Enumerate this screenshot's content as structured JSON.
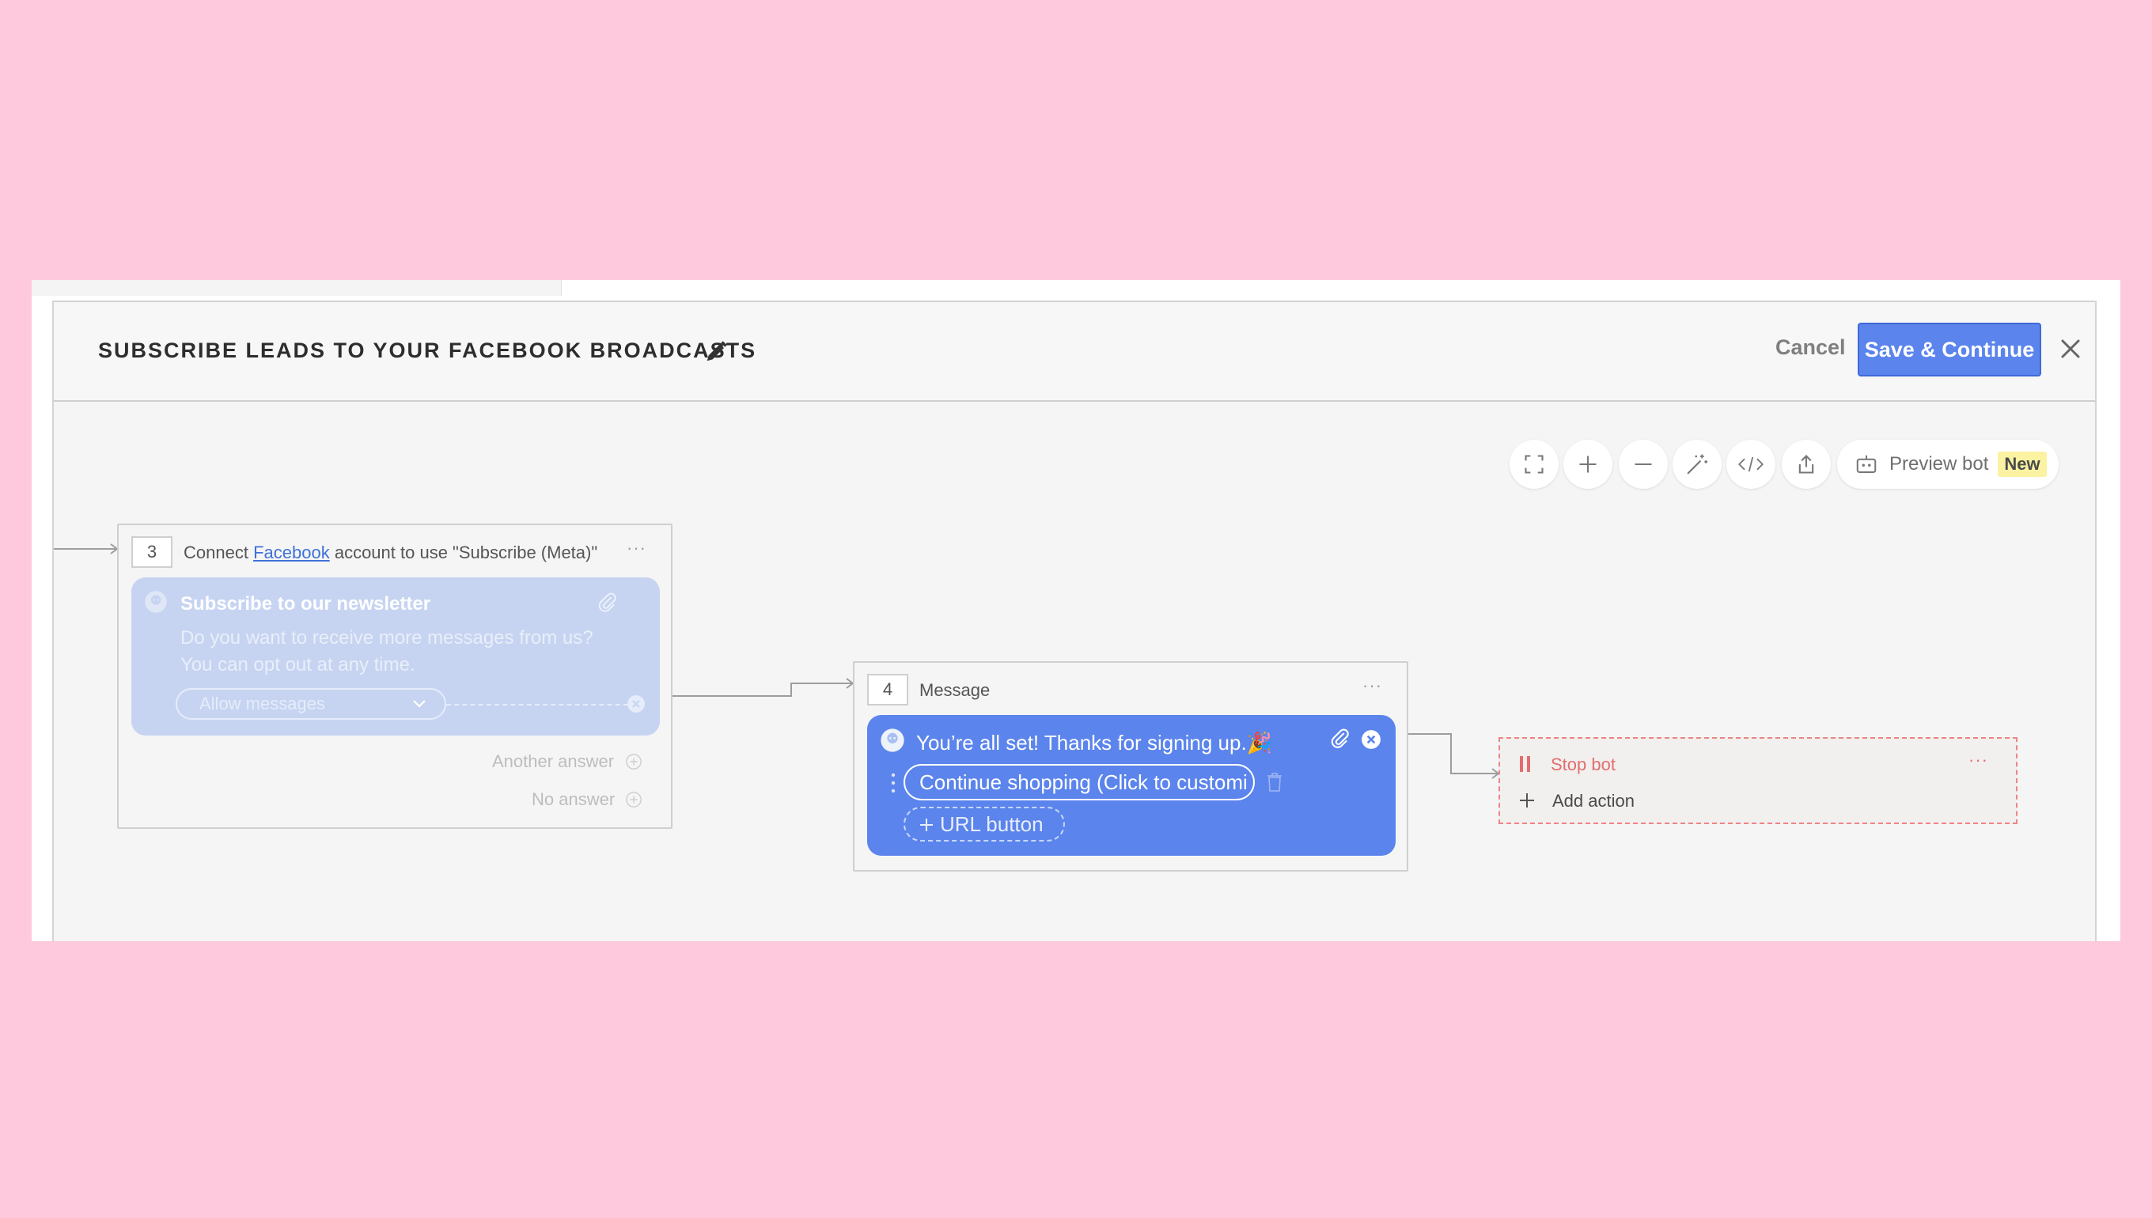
{
  "modal": {
    "title": "SUBSCRIBE LEADS TO YOUR FACEBOOK BROADCASTS",
    "cancel_label": "Cancel",
    "save_label": "Save & Continue"
  },
  "toolbar": {
    "tools": [
      "fullscreen-icon",
      "zoom-in-icon",
      "zoom-out-icon",
      "magic-wand-icon",
      "code-icon",
      "share-icon"
    ],
    "preview_label": "Preview bot",
    "new_badge": "New"
  },
  "step3": {
    "number": "3",
    "title_prefix": "Connect",
    "link_text": "Facebook",
    "title_suffix": "account to use \"Subscribe (Meta)\"",
    "card_title": "Subscribe to our newsletter",
    "card_body": "Do you want to receive more messages from us? You can opt out at any time.",
    "select_value": "Allow messages",
    "another_answer": "Another answer",
    "no_answer": "No answer"
  },
  "step4": {
    "number": "4",
    "title": "Message",
    "message_text": "You’re all set! Thanks for signing up.🎉",
    "button_label": "Continue shopping (Click to customi",
    "url_button_label": "URL button"
  },
  "stop": {
    "label": "Stop bot",
    "add_action": "Add action"
  },
  "colors": {
    "accent": "#5b84ec",
    "stop_red": "#e46d6d",
    "background": "#fec8dd"
  }
}
